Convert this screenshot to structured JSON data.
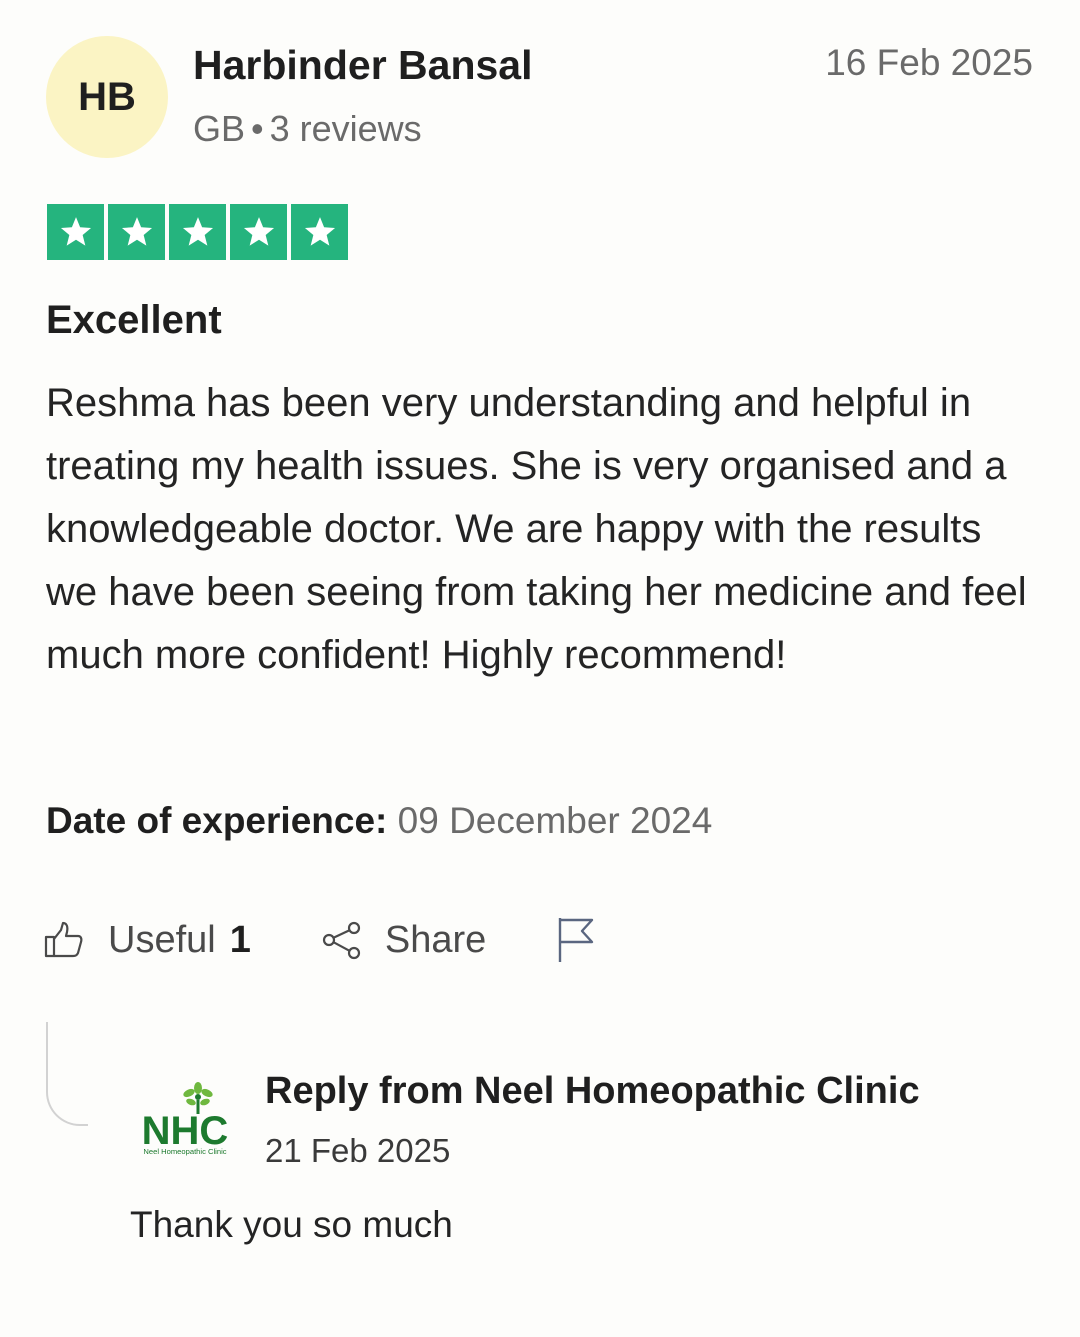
{
  "reviewer": {
    "initials": "HB",
    "name": "Harbinder Bansal",
    "country": "GB",
    "review_count": "3 reviews",
    "avatar_color": "#fbf4c4"
  },
  "review": {
    "date": "16 Feb 2025",
    "rating": 5,
    "rating_max": 5,
    "star_color": "#25b47e",
    "title": "Excellent",
    "body": "Reshma has been very understanding and helpful in treating my health issues. She is very organised and a knowledgeable doctor. We are happy with the results we have been seeing from taking her medicine and feel much more confident! Highly recommend!",
    "experience_label": "Date of experience:",
    "experience_date": "09 December 2024"
  },
  "actions": {
    "useful_label": "Useful",
    "useful_count": "1",
    "share_label": "Share",
    "icons": [
      "thumbs-up-icon",
      "share-icon",
      "flag-icon"
    ]
  },
  "reply": {
    "title": "Reply from Neel Homeopathic Clinic",
    "date": "21 Feb 2025",
    "text": "Thank you so much",
    "logo": {
      "abbr": "NHC",
      "subtitle": "Neel Homeopathic Clinic",
      "color": "#1d7a2e"
    }
  }
}
